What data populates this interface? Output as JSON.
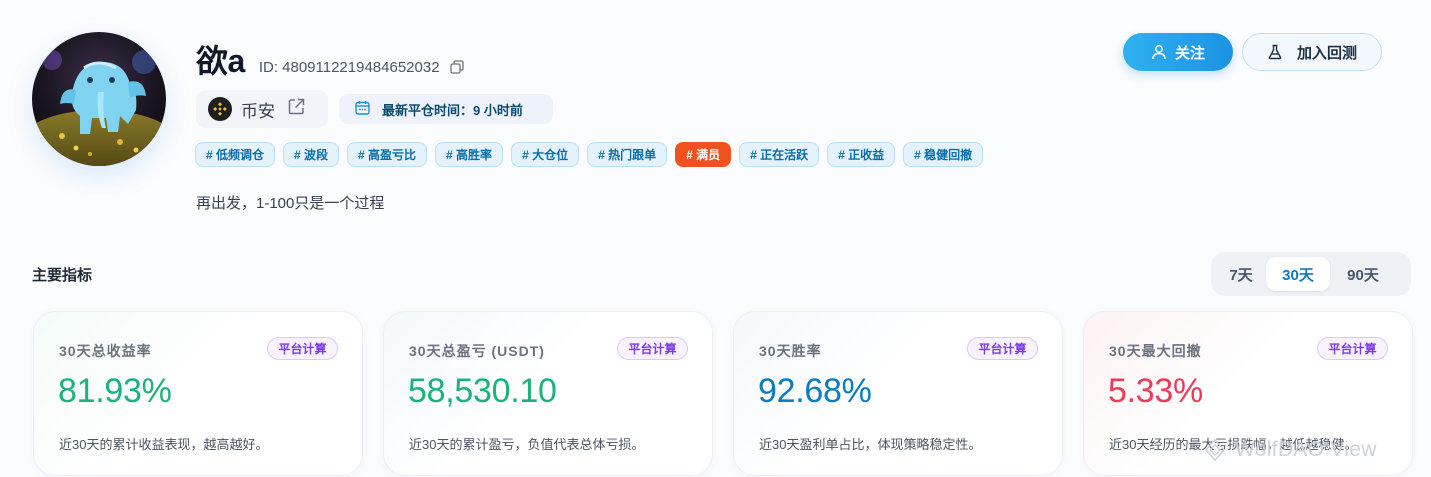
{
  "profile": {
    "name": "欲a",
    "id_text": "ID: 4809112219484652032",
    "exchange": "币安",
    "last_close": "最新平仓时间：9 小时前",
    "tags": [
      "# 低频调仓",
      "# 波段",
      "# 高盈亏比",
      "# 高胜率",
      "# 大仓位",
      "# 热门跟单",
      "# 满员",
      "# 正在活跃",
      "# 正收益",
      "# 稳健回撤"
    ],
    "bio": "再出发，1-100只是一个过程"
  },
  "actions": {
    "follow": "关注",
    "backtest": "加入回测"
  },
  "metrics": {
    "title": "主要指标",
    "periods": [
      "7天",
      "30天",
      "90天"
    ],
    "active_period": "30天",
    "badge": "平台计算",
    "cards": [
      {
        "title": "30天总收益率",
        "value": "81.93%",
        "desc": "近30天的累计收益表现，越高越好。",
        "color": "#1bb37a"
      },
      {
        "title": "30天总盈亏 (USDT)",
        "value": "58,530.10",
        "desc": "近30天的累计盈亏，负值代表总体亏损。",
        "color": "#1bb37a"
      },
      {
        "title": "30天胜率",
        "value": "92.68%",
        "desc": "近30天盈利单占比，体现策略稳定性。",
        "color": "#0b7cc1"
      },
      {
        "title": "30天最大回撤",
        "value": "5.33%",
        "desc": "近30天经历的最大亏损跌幅，越低越稳健。",
        "color": "#ee3b5b"
      }
    ]
  },
  "watermark": "WolfDAO View",
  "colors": {
    "accent": "#1b93e4",
    "positive": "#1bb37a",
    "blue_value": "#0b7cc1",
    "negative": "#ee3b5b",
    "hot_tag": "#f0511f",
    "badge_purple": "#7c3aed"
  }
}
